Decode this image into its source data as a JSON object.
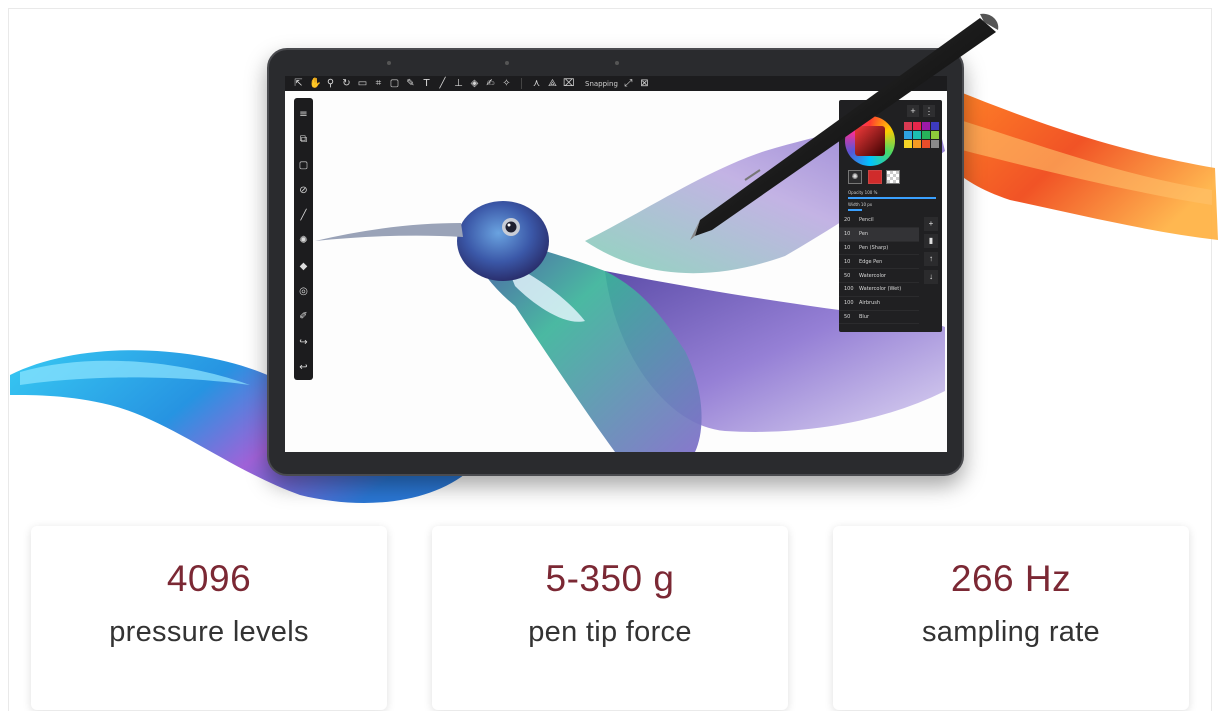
{
  "colors": {
    "stat_value": "#7b2834",
    "stat_label": "#333333",
    "tablet_body": "#2a2b2e",
    "app_chrome": "#1c1c1e",
    "stroke_blue": "#1aa8e8",
    "stroke_orange": "#f25a1c"
  },
  "app": {
    "toolbar": {
      "icons": [
        "select-icon",
        "hand-icon",
        "zoom-icon",
        "rotate-icon",
        "camera-icon",
        "transform-icon",
        "rect-select-icon",
        "pen-icon",
        "text-icon",
        "line-icon",
        "stamp-icon",
        "eraser-icon",
        "smudge-icon",
        "pin-icon",
        "symmetry-icon",
        "perspective-icon",
        "mesh-icon"
      ],
      "snapping_label": "Snapping"
    },
    "side_toolbar": {
      "icons": [
        "menu-icon",
        "new-layer-icon",
        "canvas-icon",
        "no-entry-icon",
        "brush-icon",
        "palette-icon",
        "layers-icon",
        "timer-icon",
        "eyedropper-icon",
        "redo-icon",
        "undo-icon"
      ]
    },
    "brush_panel": {
      "opacity_label": "Opacity 100 %",
      "width_label": "Width 10 px",
      "swatch_colors": [
        "#d83a52",
        "#e8264b",
        "#9b1aa8",
        "#3d3bbd",
        "#2ea2e0",
        "#1cc0b0",
        "#27b35a",
        "#8ecb3a",
        "#f5d327",
        "#f59a23",
        "#e84d2a",
        "#8a8a8a"
      ],
      "brushes": [
        {
          "size": "20",
          "name": "Pencil"
        },
        {
          "size": "10",
          "name": "Pen"
        },
        {
          "size": "10",
          "name": "Pen (Sharp)"
        },
        {
          "size": "10",
          "name": "Edge Pen"
        },
        {
          "size": "50",
          "name": "Watercolor"
        },
        {
          "size": "100",
          "name": "Watercolor (Wet)"
        },
        {
          "size": "100",
          "name": "Airbrush"
        },
        {
          "size": "50",
          "name": "Blur"
        }
      ],
      "selected_brush": "Pen"
    }
  },
  "stats": [
    {
      "value": "4096",
      "label": "pressure levels"
    },
    {
      "value": "5-350 g",
      "label": "pen tip force"
    },
    {
      "value": "266 Hz",
      "label": "sampling rate"
    }
  ]
}
